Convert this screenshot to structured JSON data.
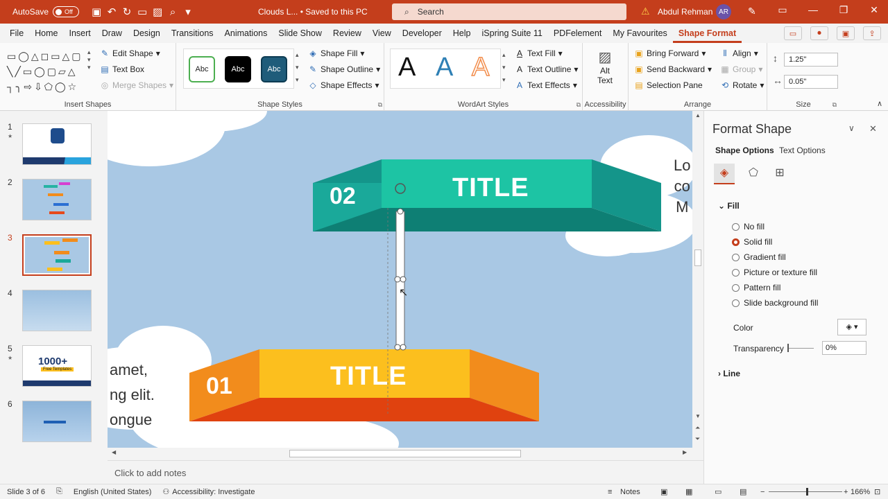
{
  "titlebar": {
    "autosave_label": "AutoSave",
    "autosave_state": "Off",
    "doc_title": "Clouds L... • Saved to this PC",
    "search_placeholder": "Search",
    "user_name": "Abdul Rehman",
    "user_initials": "AR"
  },
  "menu": {
    "items": [
      "File",
      "Home",
      "Insert",
      "Draw",
      "Design",
      "Transitions",
      "Animations",
      "Slide Show",
      "Review",
      "View",
      "Developer",
      "Help",
      "iSpring Suite 11",
      "PDFelement",
      "My Favourites",
      "Shape Format"
    ],
    "active": "Shape Format"
  },
  "ribbon": {
    "insert_shapes": {
      "label": "Insert Shapes",
      "edit_shape": "Edit Shape",
      "text_box": "Text Box",
      "merge_shapes": "Merge Shapes"
    },
    "shape_styles": {
      "label": "Shape Styles",
      "swatch": "Abc",
      "fill": "Shape Fill",
      "outline": "Shape Outline",
      "effects": "Shape Effects"
    },
    "wordart": {
      "label": "WordArt Styles",
      "letter": "A",
      "text_fill": "Text Fill",
      "text_outline": "Text Outline",
      "text_effects": "Text Effects"
    },
    "accessibility": {
      "label": "Accessibility",
      "alt_text_1": "Alt",
      "alt_text_2": "Text"
    },
    "arrange": {
      "label": "Arrange",
      "bring_forward": "Bring Forward",
      "send_backward": "Send Backward",
      "selection_pane": "Selection Pane",
      "align": "Align",
      "group": "Group",
      "rotate": "Rotate"
    },
    "size": {
      "label": "Size",
      "height": "1.25\"",
      "width": "0.05\""
    }
  },
  "slides": {
    "numbers": [
      "1",
      "2",
      "3",
      "4",
      "5",
      "6"
    ],
    "star": "★",
    "thumb5_text": "1000+",
    "thumb5_sub": "Free Templates"
  },
  "slide": {
    "banner_top": {
      "number": "02",
      "title": "TITLE"
    },
    "banner_bottom": {
      "number": "01",
      "title": "TITLE"
    },
    "text_left": [
      "amet,",
      "ng elit.",
      "ongue"
    ],
    "text_right": [
      "Lo",
      "co",
      "M"
    ]
  },
  "notes_placeholder": "Click to add notes",
  "pane": {
    "title": "Format Shape",
    "tab_shape": "Shape Options",
    "tab_text": "Text Options",
    "fill_section": "Fill",
    "fill_options": [
      "No fill",
      "Solid fill",
      "Gradient fill",
      "Picture or texture fill",
      "Pattern fill",
      "Slide background fill"
    ],
    "selected_fill": "Solid fill",
    "color_label": "Color",
    "transparency_label": "Transparency",
    "transparency_value": "0%",
    "line_section": "Line"
  },
  "status": {
    "slide_count": "Slide 3 of 6",
    "language": "English (United States)",
    "accessibility": "Accessibility: Investigate",
    "notes": "Notes",
    "zoom": "166%"
  },
  "colors": {
    "accent": "#c43e1c",
    "teal": "#1aa99a",
    "orange": "#f28c1c",
    "yellow": "#fcbf1e",
    "sky": "#a9c8e4"
  }
}
